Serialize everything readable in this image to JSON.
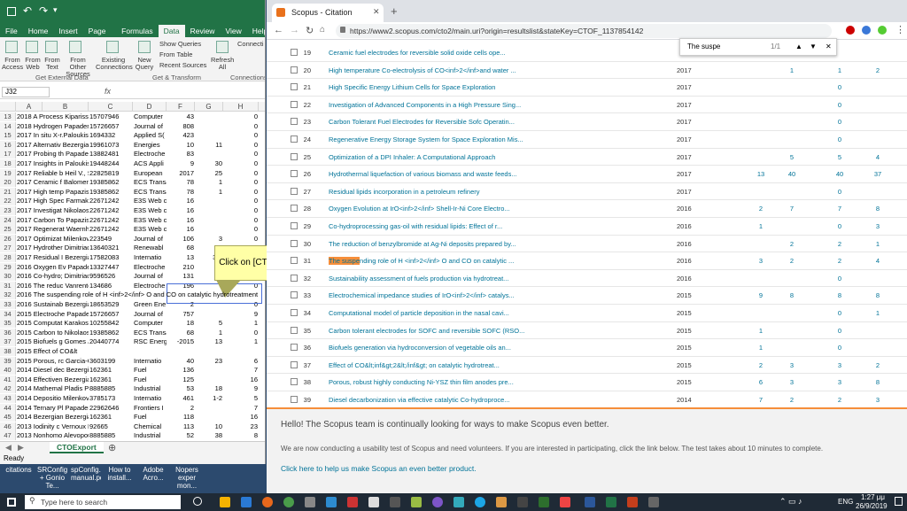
{
  "excel": {
    "title_bar_label": "",
    "tabs": [
      "File",
      "Home",
      "Insert",
      "Page Layout",
      "Formulas",
      "Data",
      "Review",
      "View",
      "Help"
    ],
    "active_tab": "Data",
    "ribbon": {
      "b1": "From Access",
      "b2": "From Web",
      "b3": "From Text",
      "b4": "From Other Sources",
      "b5": "Existing Connections",
      "b6": "New Query",
      "b7": "Show Queries",
      "b8": "From Table",
      "b9": "Recent Sources",
      "b10": "Refresh All",
      "b11": "Connecti",
      "g1": "Get External Data",
      "g2": "Get & Transform",
      "g3": "Connections"
    },
    "name_box": "J32",
    "fx": "fx",
    "columns": [
      "A",
      "B",
      "C",
      "D",
      "E",
      "F",
      "G",
      "H"
    ],
    "rows": [
      [
        "13",
        "2018 A Process Kiparissid",
        "15707946",
        "Computer",
        "43",
        "",
        "0"
      ],
      [
        "14",
        "2018 Hydrogen Papaderal",
        "15726657",
        "Journal of",
        "808",
        "",
        "0"
      ],
      [
        "15",
        "2017 In situ X-r.Paloukis F",
        "1694332",
        "Applied S(",
        "423",
        "",
        "0"
      ],
      [
        "16",
        "2017 Alternativ Bezergian",
        "19961073",
        "Energies",
        "10",
        "11",
        "0"
      ],
      [
        "17",
        "2017 Probing th Papaderal",
        "13882481",
        "Electroche",
        "83",
        "",
        "0"
      ],
      [
        "18",
        "2017 Insights in Paloukis F",
        "19448244",
        "ACS Appli",
        "9",
        "30",
        "0"
      ],
      [
        "19",
        "2017 Reliable b Heil V., Sc",
        "22825819",
        "European",
        "2017",
        "25",
        "0"
      ],
      [
        "20",
        "2017 Ceramic f Balomeno",
        "19385862",
        "ECS Transa",
        "78",
        "1",
        "0"
      ],
      [
        "21",
        "2017 High temp Papazisi K",
        "19385862",
        "ECS Transa",
        "78",
        "1",
        "0"
      ],
      [
        "22",
        "2017 High Spec Farmakis F",
        "22671242",
        "E3S Web c",
        "16",
        "",
        "0"
      ],
      [
        "23",
        "2017 Investigat Nikolaos F",
        "22671242",
        "E3S Web c",
        "16",
        "",
        "0"
      ],
      [
        "24",
        "2017 Carbon To Papazisi K",
        "22671242",
        "E3S Web c",
        "16",
        "",
        "0"
      ],
      [
        "25",
        "2017 Regenerat Waernhus",
        "22671242",
        "E3S Web c",
        "16",
        "",
        "0"
      ],
      [
        "26",
        "2017 Optimizat Milenkovi",
        "223549",
        "Journal of",
        "106",
        "3",
        "0"
      ],
      [
        "27",
        "2017 Hydrother Dimitriadi",
        "13640321",
        "Renewabl",
        "68",
        "",
        "0"
      ],
      [
        "28",
        "2017 Residual I Bezergian",
        "17582083",
        "Internatio",
        "13",
        "3-4",
        "0"
      ],
      [
        "29",
        "2016 Oxygen Ev Papaderal",
        "13327447",
        "Electroche",
        "210",
        "",
        "0"
      ],
      [
        "30",
        "2016 Co-hydro; Dimitriadi",
        "9596526",
        "Journal of",
        "131",
        "",
        "0"
      ],
      [
        "31",
        "2016 The reduc Vanrentec",
        "134686",
        "Electroche",
        "196",
        "",
        "0"
      ],
      [
        "32",
        "2016 The suspending role of H <inf>2</inf> O and CO on catalytic hydrotreatment",
        "",
        "",
        "",
        "",
        ""
      ],
      [
        "33",
        "2016 Sustainab Bezergian",
        "18653529",
        "Green Ene",
        "2",
        "",
        "0"
      ],
      [
        "34",
        "2015 Electroche Papaderal",
        "15726657",
        "Journal of",
        "757",
        "",
        "9"
      ],
      [
        "35",
        "2015 Computat Karakosta",
        "10255842",
        "Computer",
        "18",
        "5",
        "1"
      ],
      [
        "36",
        "2015 Carbon to Nikolaos F",
        "19385862",
        "ECS Transa",
        "68",
        "1",
        "0"
      ],
      [
        "37",
        "2015 Biofuels g Gomes J.F",
        "20440774",
        "RSC Energ",
        "-2015",
        "13",
        "1"
      ],
      [
        "38",
        "2015 Effect of CO&lt",
        "",
        "",
        "",
        "",
        ""
      ],
      [
        "39",
        "2015 Porous, rc Garcia-Gai",
        "3603199",
        "Internatio",
        "40",
        "23",
        "6"
      ],
      [
        "40",
        "2014 Diesel dec Bezergian",
        "162361",
        "Fuel",
        "136",
        "",
        "7"
      ],
      [
        "41",
        "2014 Effectiven Bezergian",
        "162361",
        "Fuel",
        "125",
        "",
        "16"
      ],
      [
        "42",
        "2014 Mathemal Pladis P.,",
        "8885885",
        "Industrial",
        "53",
        "18",
        "9"
      ],
      [
        "43",
        "2014 Depositio Milenkovi",
        "3785173",
        "Internatio",
        "461",
        "1-2",
        "5"
      ],
      [
        "44",
        "2014 Ternary Pl Papaderal",
        "22962646",
        "Frontiers I",
        "2",
        "",
        "7"
      ],
      [
        "45",
        "2014 Bezergian Bezergian",
        "162361",
        "Fuel",
        "118",
        "",
        "16"
      ],
      [
        "46",
        "2013 Iodinity c Vernoux P",
        "92665",
        "Chemical",
        "113",
        "10",
        "23"
      ],
      [
        "47",
        "2013 Nonhomo Alevopou",
        "8885885",
        "Industrial",
        "52",
        "38",
        "8"
      ]
    ],
    "sheet_tab": "CTOExport",
    "status": "Ready"
  },
  "callout": {
    "text": "Click on [CTOExport.csv]"
  },
  "chrome": {
    "tab_title": "Scopus - Citation overview",
    "url": "https://www2.scopus.com/cto2/main.uri?origin=resultslist&stateKey=CTOF_1137854142",
    "find_query": "The suspe",
    "find_count": "1/1",
    "rows": [
      {
        "n": "19",
        "t": "Ceramic fuel electrodes for reversible solid oxide cells ope...",
        "y": "",
        "a": "",
        "b": "",
        "c": "",
        "d": "",
        "e": ""
      },
      {
        "n": "20",
        "t": "High temperature Co-electrolysis of CO<inf>2</inf>and water ...",
        "y": "2017",
        "a": "",
        "b": "1",
        "c": "1",
        "d": "2",
        "e": ""
      },
      {
        "n": "21",
        "t": "High Specific Energy Lithium Cells for Space Exploration",
        "y": "2017",
        "a": "",
        "b": "",
        "c": "0",
        "d": "",
        "e": ""
      },
      {
        "n": "22",
        "t": "Investigation of Advanced Components in a High Pressure Sing...",
        "y": "2017",
        "a": "",
        "b": "",
        "c": "0",
        "d": "",
        "e": ""
      },
      {
        "n": "23",
        "t": "Carbon Tolerant Fuel Electrodes for Reversible Sofc Operatin...",
        "y": "2017",
        "a": "",
        "b": "",
        "c": "0",
        "d": "",
        "e": ""
      },
      {
        "n": "24",
        "t": "Regenerative Energy Storage System for Space Exploration Mis...",
        "y": "2017",
        "a": "",
        "b": "",
        "c": "0",
        "d": "",
        "e": ""
      },
      {
        "n": "25",
        "t": "Optimization of a DPI Inhaler: A Computational Approach",
        "y": "2017",
        "a": "",
        "b": "5",
        "c": "5",
        "d": "4",
        "e": ""
      },
      {
        "n": "26",
        "t": "Hydrothermal liquefaction of various biomass and waste feeds...",
        "y": "2017",
        "a": "13",
        "b": "40",
        "c": "40",
        "d": "37",
        "e": "5"
      },
      {
        "n": "27",
        "t": "Residual lipids incorporation in a petroleum refinery",
        "y": "2017",
        "a": "",
        "b": "",
        "c": "0",
        "d": "",
        "e": ""
      },
      {
        "n": "28",
        "t": "Oxygen Evolution at IrO<inf>2</inf> Shell-Ir-Ni Core Electro...",
        "y": "2016",
        "a": "2",
        "b": "7",
        "c": "7",
        "d": "8",
        "e": "1"
      },
      {
        "n": "29",
        "t": "Co-hydroprocessing gas-oil with residual lipids: Effect of r...",
        "y": "2016",
        "a": "1",
        "b": "",
        "c": "0",
        "d": "3",
        "e": ""
      },
      {
        "n": "30",
        "t": "The reduction of benzylbromide at Ag-Ni deposits prepared by...",
        "y": "2016",
        "a": "",
        "b": "2",
        "c": "2",
        "d": "1",
        "e": ""
      },
      {
        "n": "31",
        "t": "The suspending role of H <inf>2</inf> O and CO on catalytic ...",
        "y": "2016",
        "a": "3",
        "b": "2",
        "c": "2",
        "d": "4",
        "e": ""
      },
      {
        "n": "32",
        "t": "Sustainability assessment of fuels production via hydrotreat...",
        "y": "2016",
        "a": "",
        "b": "",
        "c": "0",
        "d": "",
        "e": ""
      },
      {
        "n": "33",
        "t": "Electrochemical impedance studies of IrO<inf>2</inf> catalys...",
        "y": "2015",
        "a": "9",
        "b": "8",
        "c": "8",
        "d": "8",
        "e": "1"
      },
      {
        "n": "34",
        "t": "Computational model of particle deposition in the nasal cavi...",
        "y": "2015",
        "a": "",
        "b": "",
        "c": "0",
        "d": "1",
        "e": ""
      },
      {
        "n": "35",
        "t": "Carbon tolerant electrodes for SOFC and reversible SOFC (RSO...",
        "y": "2015",
        "a": "1",
        "b": "",
        "c": "0",
        "d": "",
        "e": ""
      },
      {
        "n": "36",
        "t": "Biofuels generation via hydroconversion of vegetable oils an...",
        "y": "2015",
        "a": "1",
        "b": "",
        "c": "0",
        "d": "",
        "e": ""
      },
      {
        "n": "37",
        "t": "Effect of CO&lt;inf&gt;2&lt;/inf&gt; on catalytic hydrotreat...",
        "y": "2015",
        "a": "2",
        "b": "3",
        "c": "3",
        "d": "2",
        "e": ""
      },
      {
        "n": "38",
        "t": "Porous, robust highly conducting Ni-YSZ thin film anodes pre...",
        "y": "2015",
        "a": "6",
        "b": "3",
        "c": "3",
        "d": "8",
        "e": "1"
      },
      {
        "n": "39",
        "t": "Diesel decarbonization via effective catalytic Co-hydroproce...",
        "y": "2014",
        "a": "7",
        "b": "2",
        "c": "2",
        "d": "3",
        "e": "2"
      }
    ],
    "banner": {
      "heading": "Hello! The Scopus team is continually looking for ways to make Scopus even better.",
      "body": "We are now conducting a usability test of Scopus and need volunteers. If you are interested in participating, click the link below. The test takes about 10 minutes to complete.",
      "link": "Click here to help us make Scopus an even better product."
    }
  },
  "desktop_icons": [
    "citations",
    "SRConfig.Dll + Gonio Te...",
    "spConfig.Dll manual.pdf",
    "How to install...",
    "Adobe Acro...",
    "Nopers exper mon..."
  ],
  "taskbar": {
    "search_placeholder": "Type here to search",
    "lang": "ENG",
    "time": "1:27 μμ",
    "date": "26/9/2019"
  }
}
